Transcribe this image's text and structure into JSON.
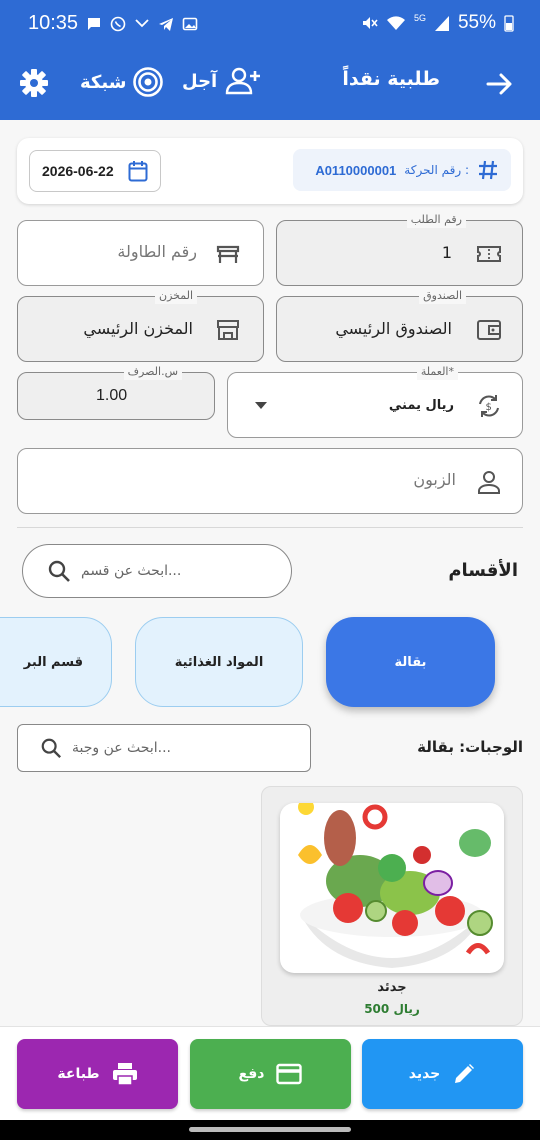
{
  "status_bar": {
    "time": "10:35",
    "network": "5G",
    "battery": "55%"
  },
  "app_bar": {
    "title": "طلبية نقداً",
    "credit_label": "آجل",
    "network_label": "شبكة"
  },
  "header": {
    "date": "2026-06-22",
    "ref_label": "رقم الحركة :",
    "ref_value": "A0110000001"
  },
  "fields": {
    "table": {
      "placeholder": "رقم الطاولة"
    },
    "order": {
      "label": "رقم الطلب",
      "value": "1"
    },
    "warehouse": {
      "label": "المخزن",
      "value": "المخزن الرئيسي"
    },
    "cashbox": {
      "label": "الصندوق",
      "value": "الصندوق الرئيسي"
    },
    "rate": {
      "label": "س.الصرف",
      "value": "1.00"
    },
    "currency": {
      "label": "العملة*",
      "value": "ريال يمني"
    },
    "customer": {
      "placeholder": "الزبون"
    }
  },
  "sections": {
    "title": "الأقسام",
    "search_placeholder": "ابحث عن قسم...",
    "chips": [
      "بقالة",
      "المواد الغذائية",
      "قسم البر"
    ]
  },
  "meals": {
    "title": "الوجبات: بقالة",
    "search_placeholder": "ابحث عن وجبة...",
    "items": [
      {
        "name": "جدئد",
        "price": "500 ريال"
      }
    ]
  },
  "actions": {
    "new": "جديد",
    "pay": "دفع",
    "print": "طباعة"
  },
  "colors": {
    "primary": "#2e6bd4",
    "pay": "#4caf50",
    "print": "#9c27b0",
    "new": "#2196f3"
  }
}
